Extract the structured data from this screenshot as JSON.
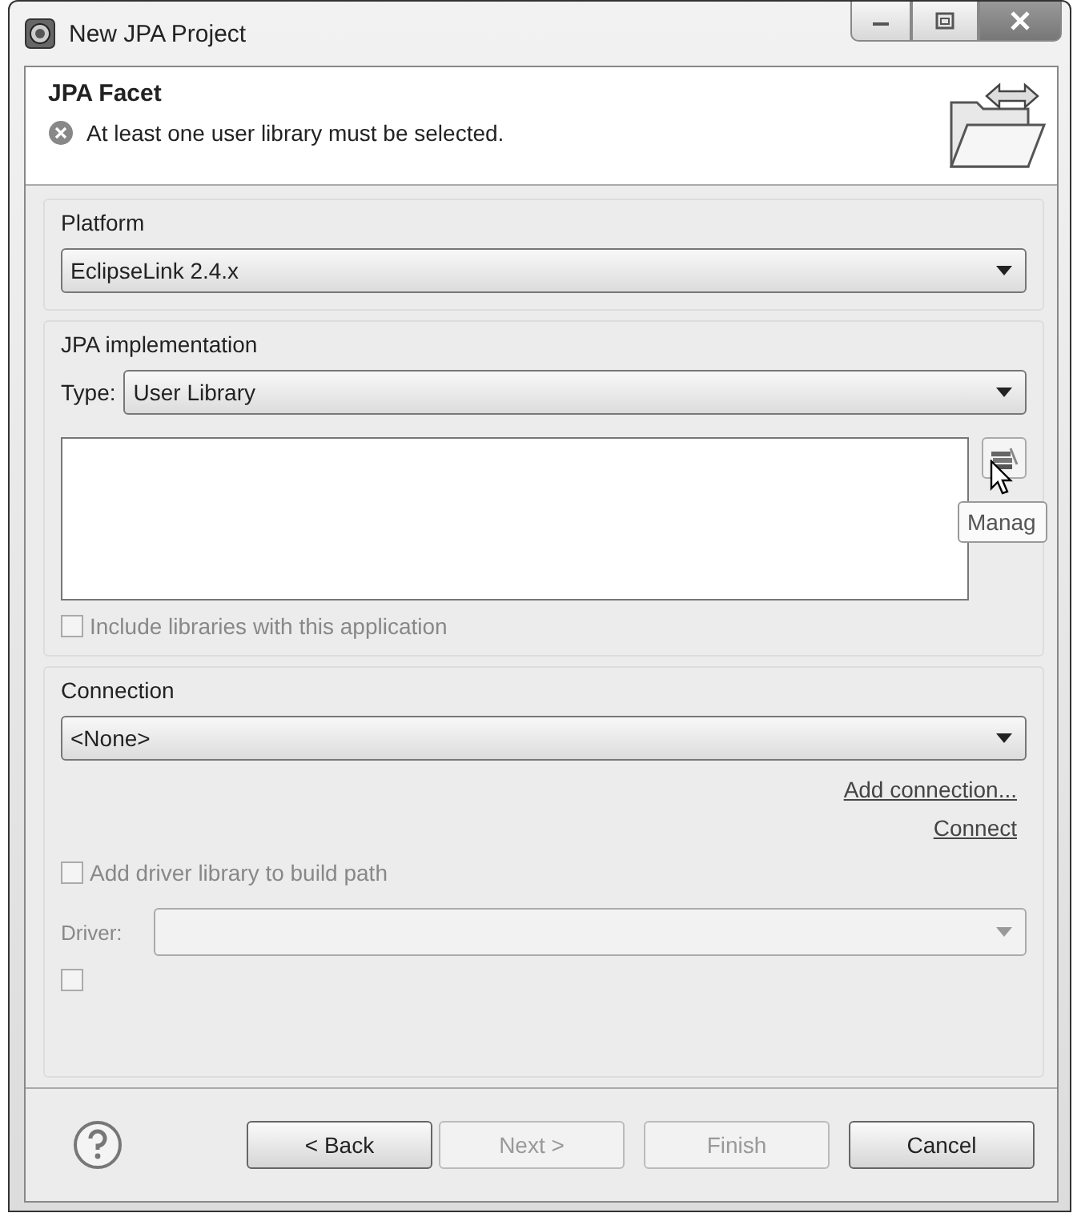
{
  "window": {
    "title": "New JPA Project"
  },
  "header": {
    "title": "JPA Facet",
    "message": {
      "kind": "error",
      "text": "At least one user library must be selected."
    }
  },
  "platform": {
    "label": "Platform",
    "value": "EclipseLink 2.4.x"
  },
  "jpa_implementation": {
    "label": "JPA implementation",
    "type_label": "Type:",
    "type_value": "User Library",
    "tooltip": "Manag",
    "include_libraries": {
      "label": "Include libraries with this application",
      "checked": false,
      "disabled": true
    }
  },
  "connection": {
    "label": "Connection",
    "value": "<None>",
    "links": [
      "Add connection...",
      "Connect"
    ],
    "add_driver_library": {
      "label": "Add driver library to build path",
      "checked": false,
      "disabled": true
    },
    "driver": {
      "label": "Driver:",
      "disabled": true
    },
    "cut_off_checkbox": {
      "checked": false
    }
  },
  "buttons": [
    {
      "label": "< Back",
      "disabled": false
    },
    {
      "label": "Next >",
      "disabled": true
    },
    {
      "label": "Finish",
      "disabled": true
    },
    {
      "label": "Cancel",
      "disabled": false
    }
  ]
}
